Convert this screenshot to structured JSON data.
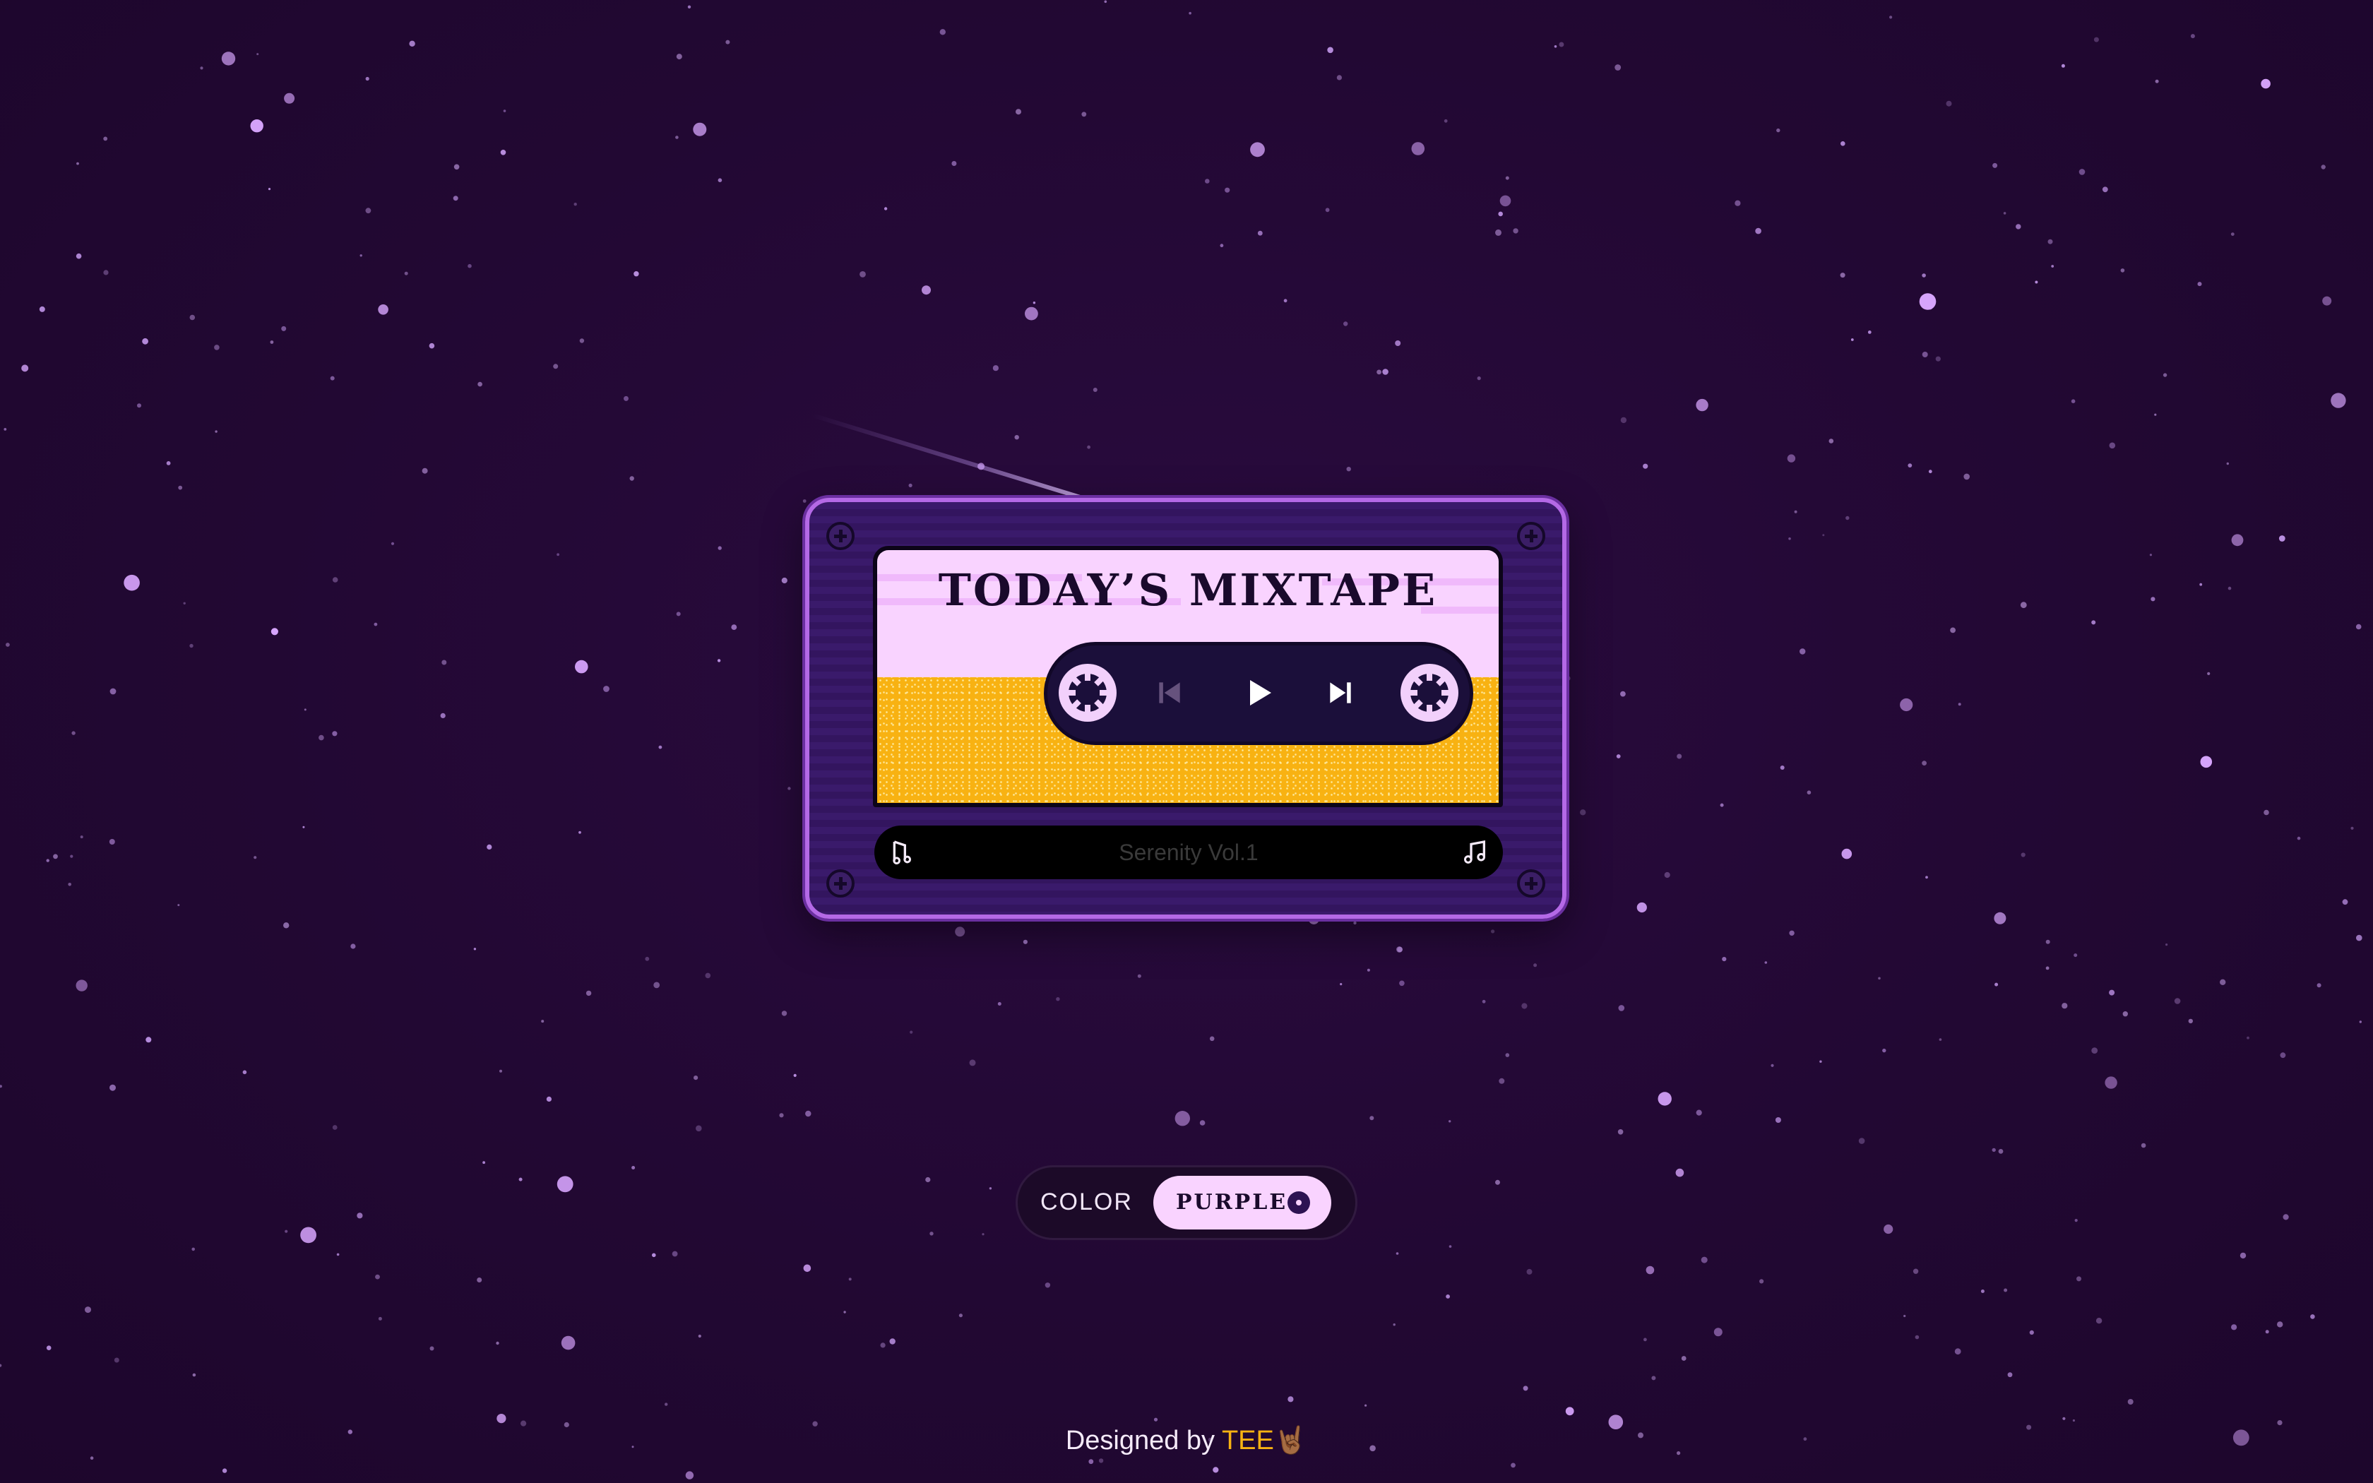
{
  "cassette": {
    "title": "TODAY’S MIXTAPE",
    "track_name": "Serenity Vol.1",
    "controls": {
      "prev_icon": "skip-previous-icon",
      "play_icon": "play-icon",
      "next_icon": "skip-next-icon"
    },
    "colors": {
      "shell": "#3a1a6b",
      "label": "#f9d3ff",
      "tape": "#f8b212"
    }
  },
  "color_switcher": {
    "label": "COLOR",
    "selected": "PURPLE"
  },
  "footer": {
    "prefix": "Designed by ",
    "author": "TEE",
    "emoji": "🤘🏾"
  }
}
